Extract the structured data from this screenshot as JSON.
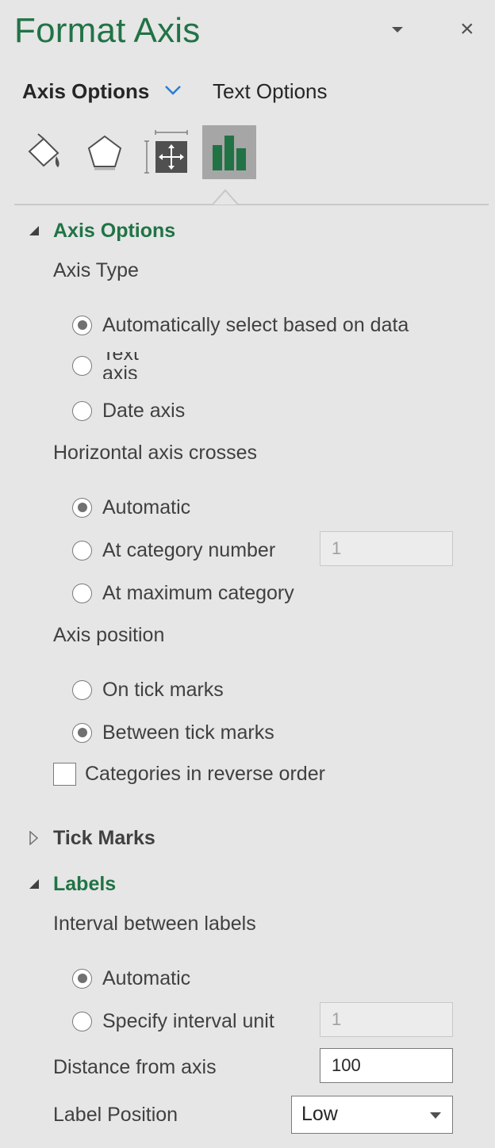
{
  "pane": {
    "title": "Format Axis",
    "close_glyph": "×"
  },
  "option_tabs": {
    "axis_options": "Axis Options",
    "text_options": "Text Options"
  },
  "icon_tabs": [
    {
      "icon": "paint-bucket-icon"
    },
    {
      "icon": "pentagon-icon"
    },
    {
      "icon": "size-properties-icon"
    },
    {
      "icon": "bar-chart-icon",
      "selected": true
    }
  ],
  "axis_options": {
    "heading": "Axis Options",
    "axis_type": {
      "label": "Axis Type",
      "options": [
        "Automatically select based on data",
        "Text axis",
        "Date axis"
      ],
      "selected": 0
    },
    "horizontal_axis_crosses": {
      "label": "Horizontal axis crosses",
      "options": [
        "Automatic",
        "At category number",
        "At maximum category"
      ],
      "selected": 0,
      "category_number_value": "1"
    },
    "axis_position": {
      "label": "Axis position",
      "options": [
        "On tick marks",
        "Between tick marks"
      ],
      "selected": 1
    },
    "reverse_order_label": "Categories in reverse order"
  },
  "tick_marks": {
    "heading": "Tick Marks"
  },
  "labels": {
    "heading": "Labels",
    "interval_label": "Interval between labels",
    "interval_options": [
      "Automatic",
      "Specify interval unit"
    ],
    "selected": 0,
    "interval_unit_value": "1",
    "distance_label": "Distance from axis",
    "distance_value": "100",
    "position_label": "Label Position",
    "position_value": "Low"
  },
  "colors": {
    "accent_green": "#217346",
    "selected_tab_bg": "#a6a6a6",
    "pane_bg": "#e6e6e6"
  }
}
